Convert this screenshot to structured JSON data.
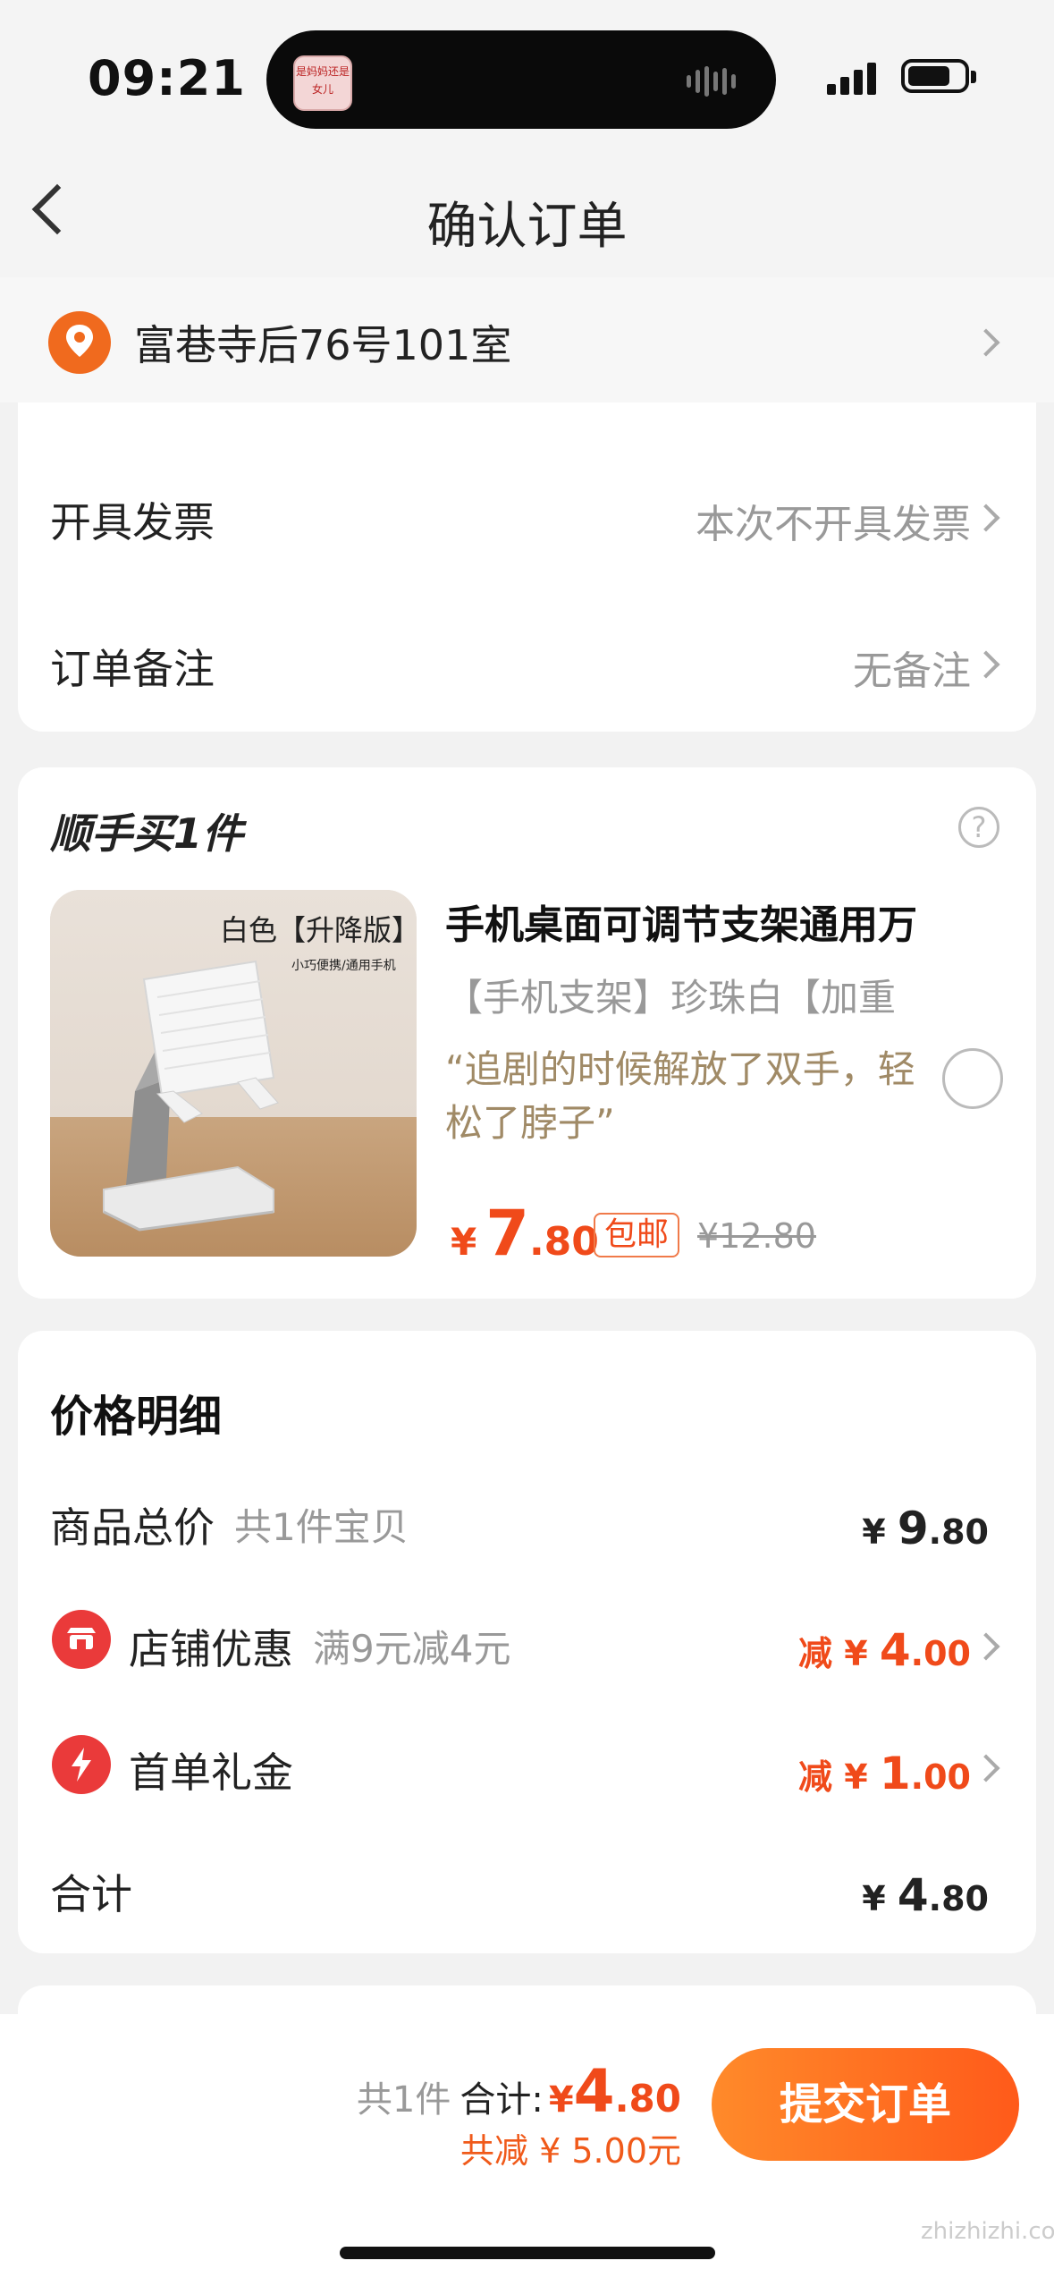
{
  "status_bar": {
    "time": "09:21",
    "island_thumb_text": "是妈妈还是女儿"
  },
  "header": {
    "title": "确认订单"
  },
  "address": {
    "text": "富巷寺后76号101室"
  },
  "invoice": {
    "label": "开具发票",
    "value": "本次不开具发票"
  },
  "remark": {
    "label": "订单备注",
    "value": "无备注"
  },
  "addon": {
    "title": "顺手买1件",
    "help": "?",
    "image_caption": "白色【升降版】",
    "image_subcaption": "小巧便携/通用手机",
    "name": "手机桌面可调节支架通用万",
    "spec": "【手机支架】珍珠白【加重",
    "quote": "“追剧的时候解放了双手，轻松了脖子”",
    "price_symbol": "¥",
    "price_int": "7",
    "price_dec": ".80",
    "badge": "包邮",
    "original_price": "¥12.80"
  },
  "price_detail": {
    "title": "价格明细",
    "rows": [
      {
        "label": "商品总价",
        "sub": "共1件宝贝",
        "prefix": "¥ ",
        "int": "9",
        "dec": ".80"
      },
      {
        "label": "店铺优惠",
        "sub": "满9元减4元",
        "prefix": "减 ¥ ",
        "int": "4",
        "dec": ".00"
      },
      {
        "label": "首单礼金",
        "sub": "",
        "prefix": "减 ¥ ",
        "int": "1",
        "dec": ".00"
      },
      {
        "label": "合计",
        "sub": "",
        "prefix": "¥ ",
        "int": "4",
        "dec": ".80"
      }
    ]
  },
  "bottom": {
    "count": "共1件",
    "total_label": "合计:",
    "total_symbol": "¥",
    "total_int": "4",
    "total_dec": ".80",
    "saved": "共减 ¥ 5.00元",
    "submit": "提交订单"
  },
  "watermark": "zhizhizhi.com",
  "colors": {
    "accent": "#f04a1a",
    "submit_gradient_start": "#ff8a2a",
    "submit_gradient_end": "#ff5a1a"
  }
}
